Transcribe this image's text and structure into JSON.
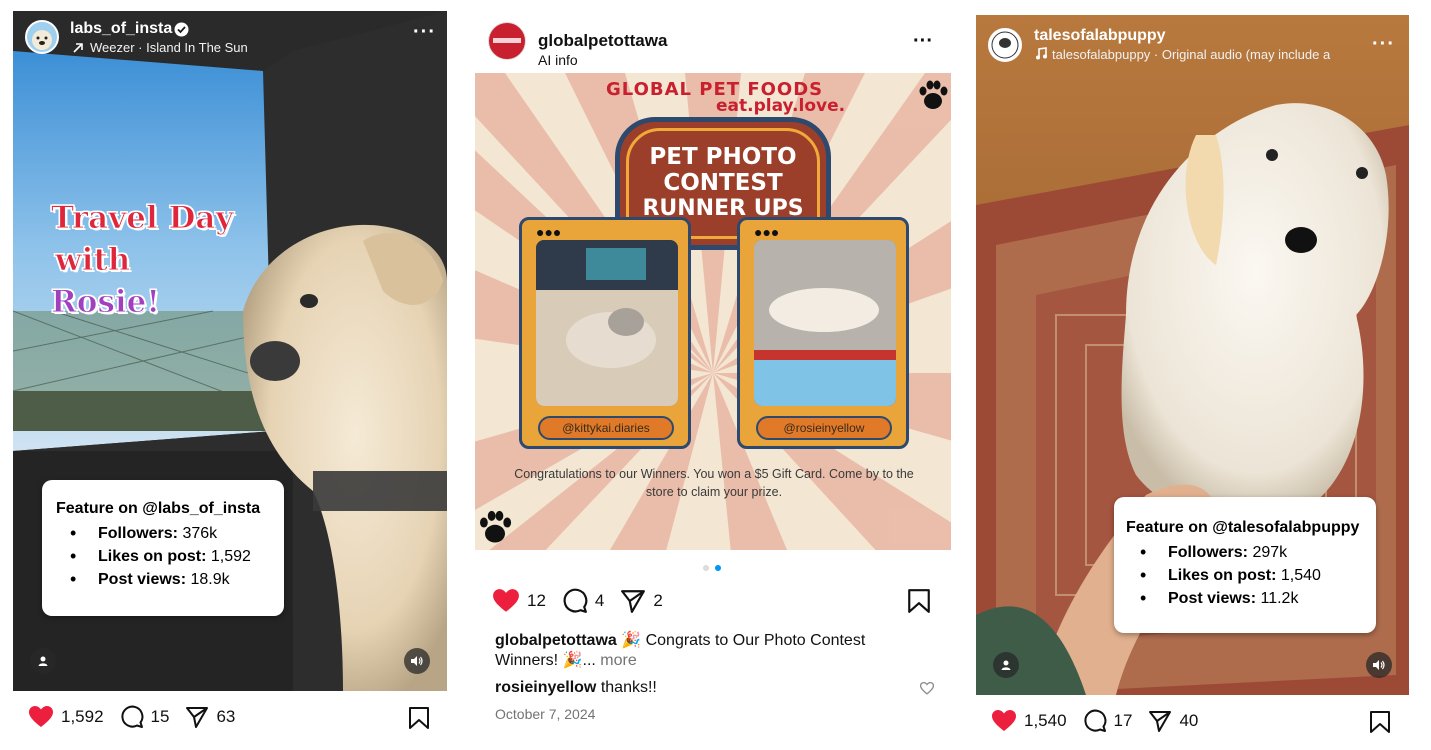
{
  "posts": [
    {
      "username": "labs_of_insta",
      "verified": true,
      "audio": "Weezer · Island In The Sun",
      "overlay_lines": [
        "Travel Day",
        "with",
        "Rosie!"
      ],
      "overlay_colors": [
        "#e0263a",
        "#e0263a",
        "#a23fbf"
      ],
      "feature": {
        "title": "Feature on @labs_of_insta",
        "followers_label": "Followers:",
        "followers": "376k",
        "likes_label": "Likes on post:",
        "likes": "1,592",
        "views_label": "Post views:",
        "views": "18.9k"
      },
      "like_count": "1,592",
      "comment_count": "15",
      "share_count": "63"
    },
    {
      "username": "globalpetottawa",
      "subtitle": "AI info",
      "brand": "GLOBAL PET FOODS",
      "tagline": "eat.play.love.",
      "banner_lines": [
        "PET PHOTO",
        "CONTEST",
        "RUNNER UPS"
      ],
      "winner1_tag": "@kittykai.diaries",
      "winner2_tag": "@rosieinyellow",
      "congrats": "Congratulations to our Winners. You won a $5 Gift Card. Come by to the store to claim your prize.",
      "like_count": "12",
      "comment_count": "4",
      "share_count": "2",
      "caption_user": "globalpetottawa",
      "caption_text": "🎉 Congrats to Our Photo Contest Winners! 🎉...",
      "caption_more": "more",
      "comment_user": "rosieinyellow",
      "comment_text": "thanks!!",
      "date": "October 7, 2024"
    },
    {
      "username": "talesofalabpuppy",
      "audio": "talesofalabpuppy · Original audio  (may include a",
      "feature": {
        "title": "Feature on @talesofalabpuppy",
        "followers_label": "Followers:",
        "followers": "297k",
        "likes_label": "Likes on post:",
        "likes": "1,540",
        "views_label": "Post views:",
        "views": "11.2k"
      },
      "like_count": "1,540",
      "comment_count": "17",
      "share_count": "40"
    }
  ],
  "colors": {
    "like_red": "#ed1f3f",
    "carousel_active": "#0095f6",
    "brand_red": "#c8202e",
    "banner_brown": "#9c3f2a"
  },
  "icons": [
    "verified-icon",
    "trend-arrow-icon",
    "more-icon",
    "user-tag-icon",
    "sound-icon",
    "heart-icon",
    "comment-icon",
    "share-icon",
    "bookmark-icon",
    "music-note-icon",
    "paw-icon",
    "small-heart-icon"
  ]
}
